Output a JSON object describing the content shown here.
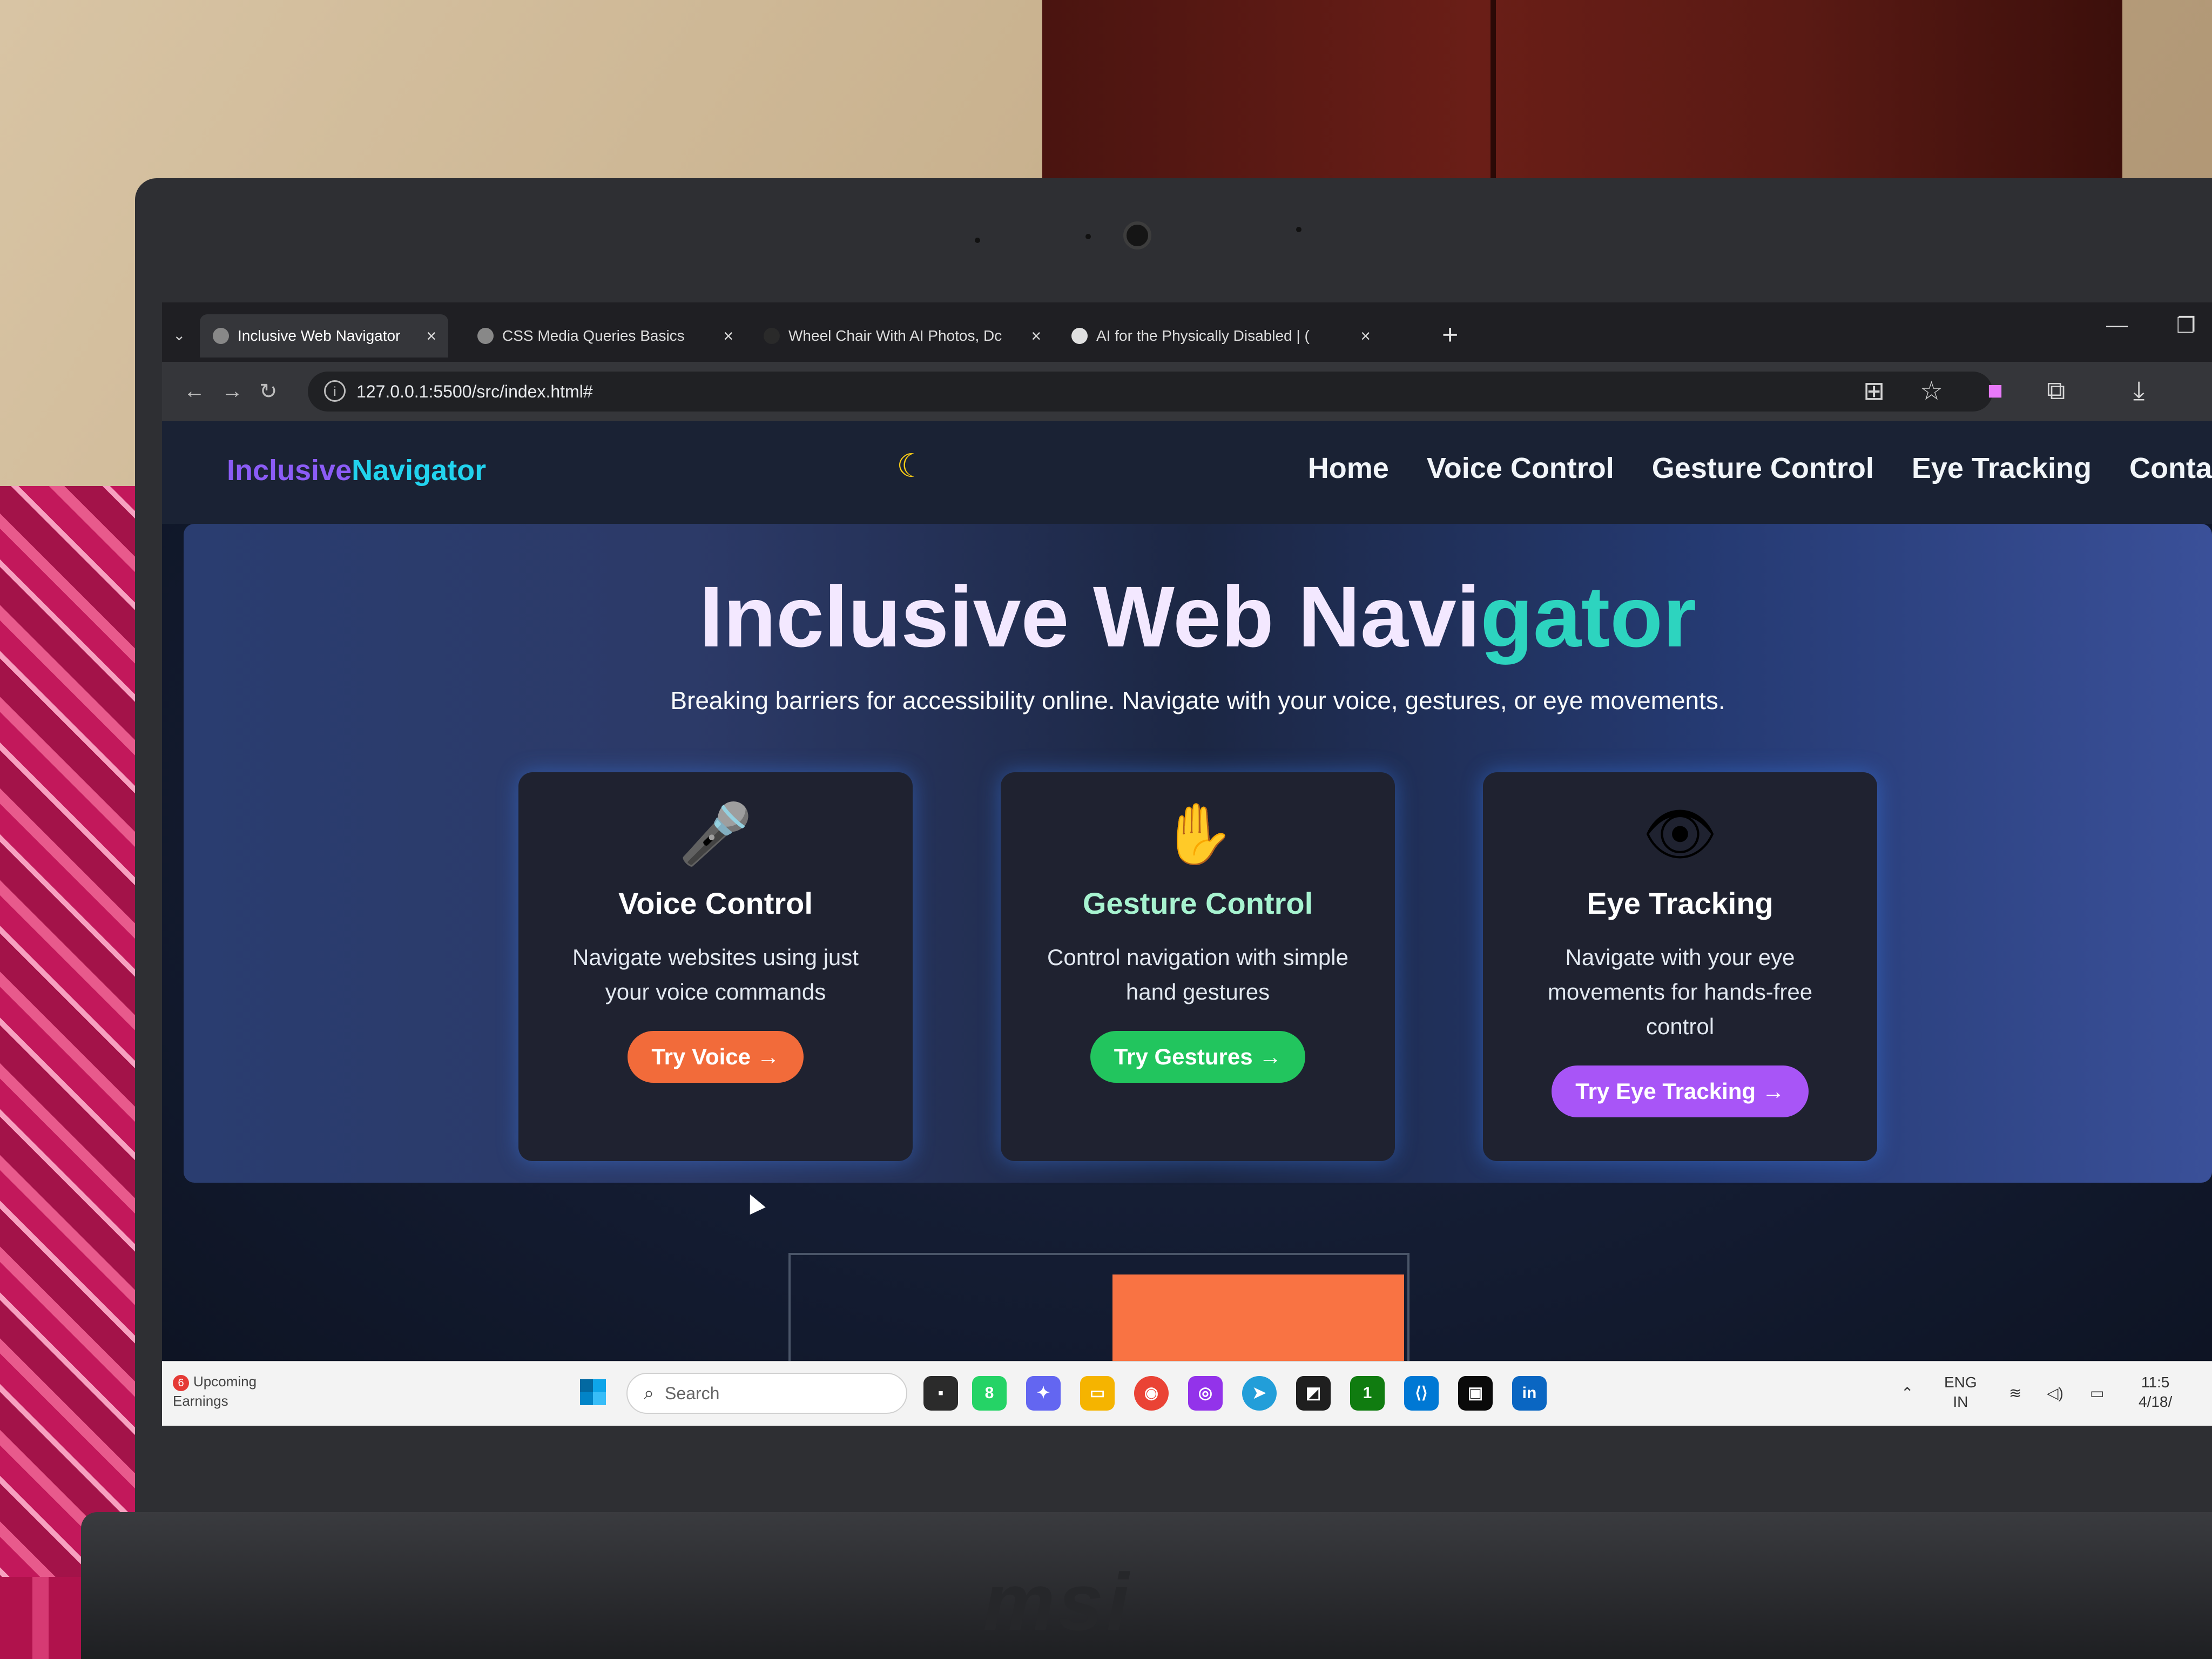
{
  "browser": {
    "tabs": [
      {
        "label": "Inclusive Web Navigator",
        "active": true
      },
      {
        "label": "CSS Media Queries Basics",
        "active": false
      },
      {
        "label": "Wheel Chair With AI Photos, Dc",
        "active": false
      },
      {
        "label": "AI for the Physically Disabled | (",
        "active": false
      }
    ],
    "url": "127.0.0.1:5500/src/index.html#",
    "icons": {
      "tab_menu": "chevron-down-icon",
      "close": "close-icon",
      "new_tab": "plus-icon",
      "back": "back-arrow-icon",
      "forward": "forward-arrow-icon",
      "reload": "reload-icon",
      "info": "site-info-icon",
      "translate": "translate-icon",
      "bookmark": "star-icon",
      "extension": "puzzle-icon",
      "download": "download-icon",
      "minimize": "minimize-icon",
      "restore": "restore-icon"
    }
  },
  "site": {
    "logo_part1": "Inclusive",
    "logo_part2": "Navigator",
    "theme_toggle_icon": "moon-icon",
    "nav": [
      "Home",
      "Voice Control",
      "Gesture Control",
      "Eye Tracking",
      "Conta"
    ],
    "hero": {
      "title_main": "Inclusive Web Navi",
      "title_accent": "gator",
      "subtitle": "Breaking barriers for accessibility online. Navigate with your voice, gestures, or eye movements."
    },
    "cards": [
      {
        "icon": "microphone-icon",
        "title": "Voice Control",
        "desc": "Navigate websites using just your voice commands",
        "button": "Try Voice →"
      },
      {
        "icon": "raised-hand-icon",
        "title": "Gesture Control",
        "desc": "Control navigation with simple hand gestures",
        "button": "Try Gestures →"
      },
      {
        "icon": "eye-icon",
        "title": "Eye Tracking",
        "desc": "Navigate with your eye movements for hands-free control",
        "button": "Try Eye Tracking →"
      }
    ],
    "colors": {
      "logo_purple": "#8b5cf6",
      "logo_cyan": "#22d3ee",
      "voice_button": "#f26b3a",
      "gesture_button": "#22c55e",
      "eye_button": "#a855f7",
      "title_accent": "#2dd4bf"
    }
  },
  "taskbar": {
    "widget_title": "Upcoming",
    "widget_sub": "Earnings",
    "widget_badge": "6",
    "search_placeholder": "Search",
    "whatsapp_badge": "8",
    "xbox_badge": "1",
    "language_top": "ENG",
    "language_bottom": "IN",
    "time": "11:5",
    "date": "4/18/"
  },
  "laptop": {
    "brand": "msi"
  }
}
